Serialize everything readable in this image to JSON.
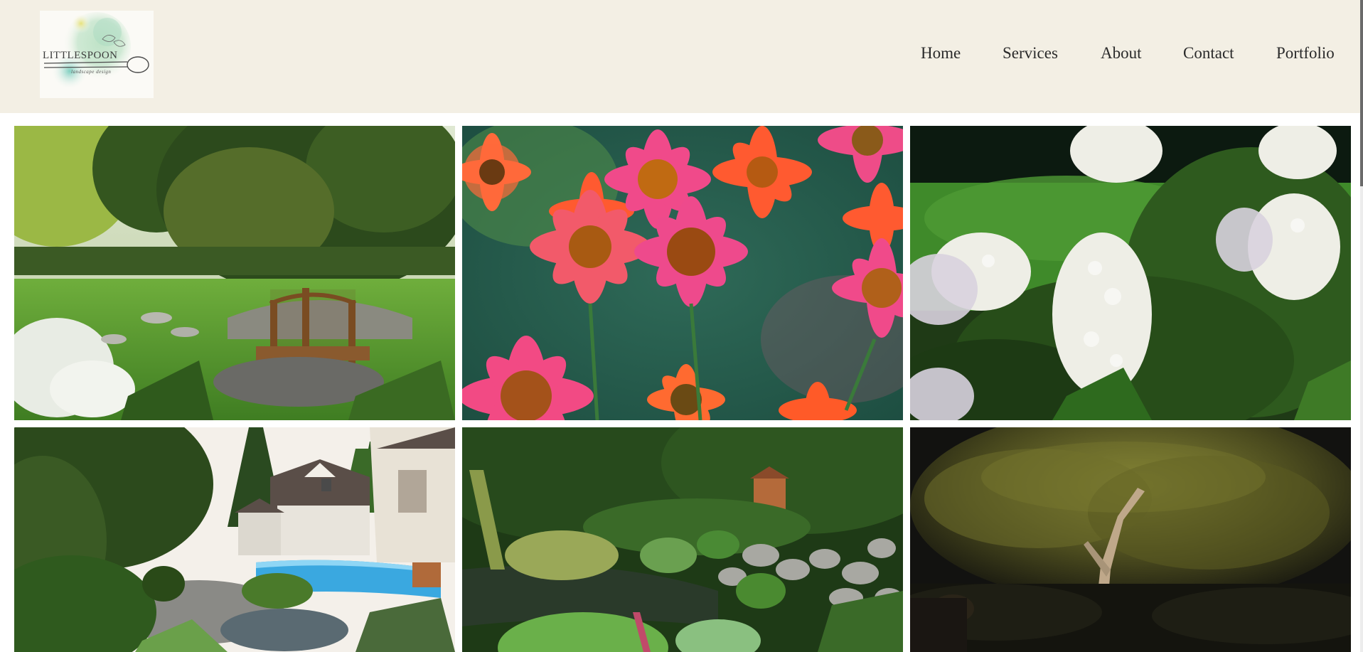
{
  "header": {
    "logo": {
      "text": "LITTLESPOON",
      "tagline": "landscape design"
    },
    "nav": [
      {
        "label": "Home"
      },
      {
        "label": "Services"
      },
      {
        "label": "About"
      },
      {
        "label": "Contact"
      },
      {
        "label": "Portfolio"
      }
    ]
  },
  "colors": {
    "header_bg": "#f3efe4",
    "page_bg": "#ffffff",
    "nav_text": "#2a2a2a"
  },
  "gallery": [
    {
      "subject": "garden-bridge-photo"
    },
    {
      "subject": "coneflowers-photo"
    },
    {
      "subject": "white-hydrangea-photo"
    },
    {
      "subject": "pool-house-garden-photo"
    },
    {
      "subject": "pond-garden-photo"
    },
    {
      "subject": "night-lit-tree-photo"
    }
  ]
}
